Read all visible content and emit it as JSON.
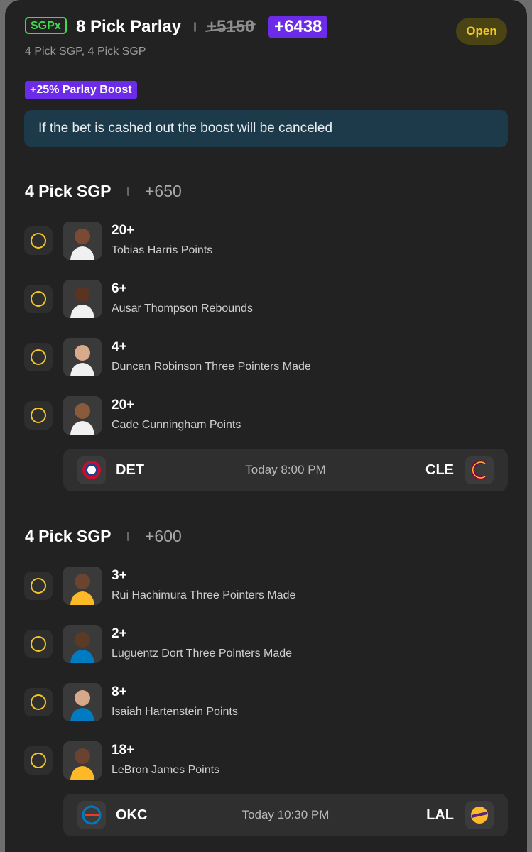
{
  "header": {
    "badge": "SGPx",
    "title": "8 Pick Parlay",
    "old_odds": "+5150",
    "new_odds": "+6438",
    "status": "Open",
    "subtitle": "4 Pick SGP, 4 Pick SGP"
  },
  "boost": {
    "label": "+25% Parlay Boost",
    "notice": "If the bet is cashed out the boost will be canceled"
  },
  "sections": [
    {
      "title": "4 Pick SGP",
      "odds": "+650",
      "picks": [
        {
          "line": "20+",
          "desc": "Tobias Harris Points"
        },
        {
          "line": "6+",
          "desc": "Ausar Thompson Rebounds"
        },
        {
          "line": "4+",
          "desc": "Duncan Robinson Three Pointers Made"
        },
        {
          "line": "20+",
          "desc": "Cade Cunningham Points"
        }
      ],
      "game": {
        "home": "DET",
        "time": "Today 8:00 PM",
        "away": "CLE"
      }
    },
    {
      "title": "4 Pick SGP",
      "odds": "+600",
      "picks": [
        {
          "line": "3+",
          "desc": "Rui Hachimura Three Pointers Made"
        },
        {
          "line": "2+",
          "desc": "Luguentz Dort Three Pointers Made"
        },
        {
          "line": "8+",
          "desc": "Isaiah Hartenstein Points"
        },
        {
          "line": "18+",
          "desc": "LeBron James Points"
        }
      ],
      "game": {
        "home": "OKC",
        "time": "Today 10:30 PM",
        "away": "LAL"
      }
    }
  ],
  "colors": {
    "accent_purple": "#6b2be8",
    "status_yellow": "#f3c623",
    "sgpx_green": "#3ddc4f",
    "notice_bg": "#1d3a4a"
  }
}
